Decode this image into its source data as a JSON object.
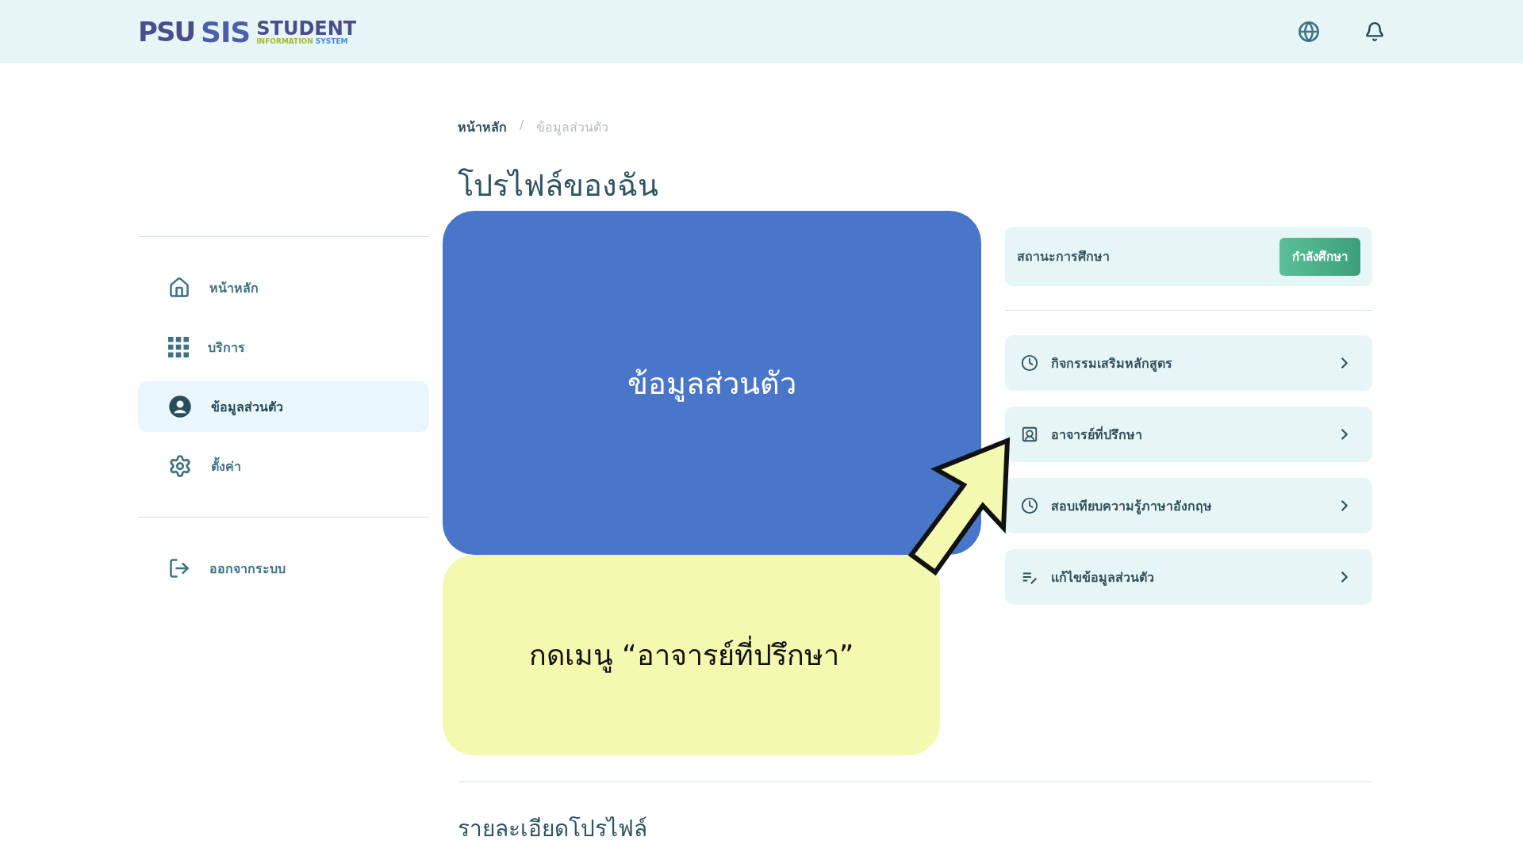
{
  "header": {
    "logo": {
      "psu": "PSU",
      "sis": "SIS",
      "title": "STUDENT",
      "subtitle_1": "INFORMATION",
      "subtitle_2": "SYSTEM"
    }
  },
  "sidebar": {
    "items": [
      {
        "label": "หน้าหลัก",
        "selected": false
      },
      {
        "label": "บริการ",
        "selected": false
      },
      {
        "label": "ข้อมูลส่วนตัว",
        "selected": true
      },
      {
        "label": "ตั้งค่า",
        "selected": false
      }
    ],
    "logout": "ออกจากระบบ"
  },
  "breadcrumb_separator": "/",
  "breadcrumb": [
    {
      "label": "หน้าหลัก",
      "selected": false
    },
    {
      "label": "ข้อมูลส่วนตัว",
      "selected": true
    }
  ],
  "title": "โปรไฟล์ของฉัน",
  "status": {
    "label": "สถานะการศึกษา",
    "value": "กำลังศึกษา"
  },
  "menu": [
    {
      "label": "กิจกรรมเสริมหลักสูตร"
    },
    {
      "label": "อาจารย์ที่ปรึกษา"
    },
    {
      "label": "สอบเทียบความรู้ภาษาอังกฤษ"
    },
    {
      "label": "แก้ไขข้อมูลส่วนตัว"
    }
  ],
  "section_title": "รายละเอียดโปรไฟล์",
  "annotation": {
    "highlight": "ข้อมูลส่วนตัว",
    "instruction": "กดเมนู “อาจารย์ที่ปรึกษา”"
  }
}
